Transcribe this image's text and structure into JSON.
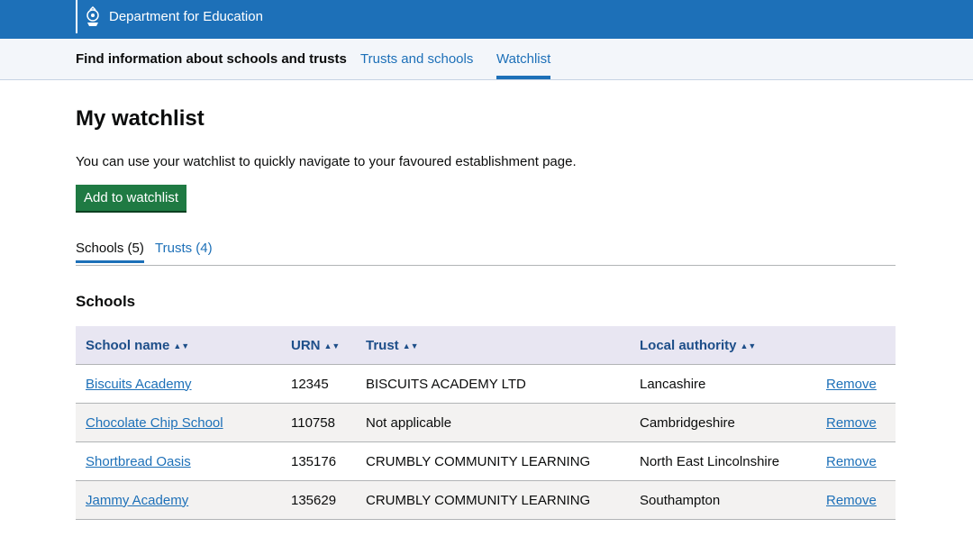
{
  "header": {
    "org_name": "Department for Education"
  },
  "service": {
    "name": "Find information about schools and trusts",
    "nav": [
      {
        "label": "Trusts and schools",
        "active": false
      },
      {
        "label": "Watchlist",
        "active": true
      }
    ]
  },
  "page": {
    "title": "My watchlist",
    "intro": "You can use your watchlist to quickly navigate to your favoured establishment page.",
    "add_button": "Add to watchlist"
  },
  "tabs": [
    {
      "label": "Schools (5)",
      "selected": true
    },
    {
      "label": "Trusts (4)",
      "selected": false
    }
  ],
  "section": {
    "title": "Schools"
  },
  "table": {
    "headers": [
      "School name",
      "URN",
      "Trust",
      "Local authority"
    ],
    "sort_glyph": "▲▼",
    "rows": [
      {
        "name": "Biscuits Academy",
        "urn": "12345",
        "trust": "BISCUITS ACADEMY LTD",
        "la": "Lancashire",
        "action": "Remove"
      },
      {
        "name": "Chocolate Chip School",
        "urn": "110758",
        "trust": "Not applicable",
        "la": "Cambridgeshire",
        "action": "Remove"
      },
      {
        "name": "Shortbread Oasis",
        "urn": "135176",
        "trust": "CRUMBLY COMMUNITY LEARNING",
        "la": "North East Lincolnshire",
        "action": "Remove"
      },
      {
        "name": "Jammy Academy",
        "urn": "135629",
        "trust": "CRUMBLY COMMUNITY LEARNING",
        "la": "Southampton",
        "action": "Remove"
      }
    ]
  },
  "colors": {
    "header_blue": "#1d70b8",
    "button_green": "#1f7a43",
    "table_header_bg": "#e8e6f2",
    "link_blue": "#1d70b8"
  }
}
